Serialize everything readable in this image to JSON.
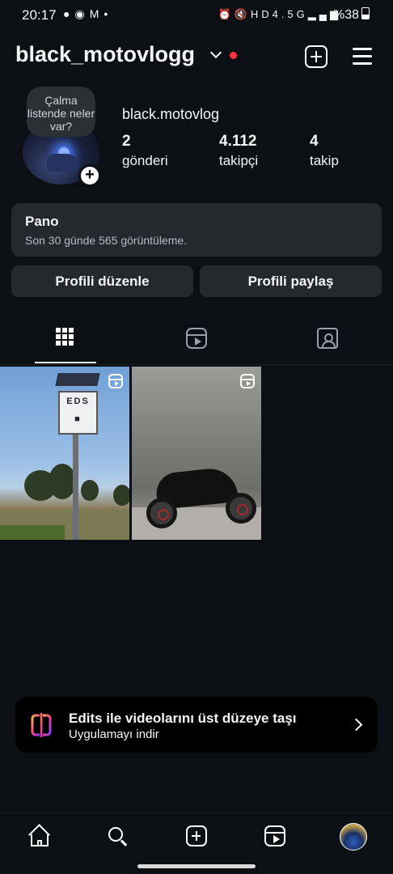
{
  "status_bar": {
    "time": "20:17",
    "network": "4.5G",
    "battery": "%38"
  },
  "header": {
    "username": "black_motovlogg",
    "accent_color": "#ff3040"
  },
  "profile": {
    "note_bubble": "Çalma listende neler var?",
    "display_name": "black.motovlog",
    "stats": {
      "posts_count": "2",
      "posts_label": "gönderi",
      "followers_count": "4.112",
      "followers_label": "takipçi",
      "following_count": "4",
      "following_label": "takip"
    }
  },
  "pano": {
    "title": "Pano",
    "subtitle": "Son 30 günde 565 görüntüleme."
  },
  "actions": {
    "edit_profile": "Profili düzenle",
    "share_profile": "Profili paylaş"
  },
  "tabs": [
    {
      "icon": "grid-icon",
      "selected": true
    },
    {
      "icon": "reels-icon",
      "selected": false
    },
    {
      "icon": "tagged-icon",
      "selected": false
    }
  ],
  "posts": [
    {
      "type": "reel",
      "subject": "speed camera pole by the sea"
    },
    {
      "type": "reel",
      "subject": "black sport motorcycle"
    }
  ],
  "banner": {
    "title": "Edits ile videolarını üst düzeye taşı",
    "subtitle": "Uygulamayı indir"
  },
  "bottom_nav": [
    {
      "icon": "home-icon"
    },
    {
      "icon": "search-icon"
    },
    {
      "icon": "create-icon"
    },
    {
      "icon": "reels-icon"
    },
    {
      "icon": "profile-avatar"
    }
  ]
}
